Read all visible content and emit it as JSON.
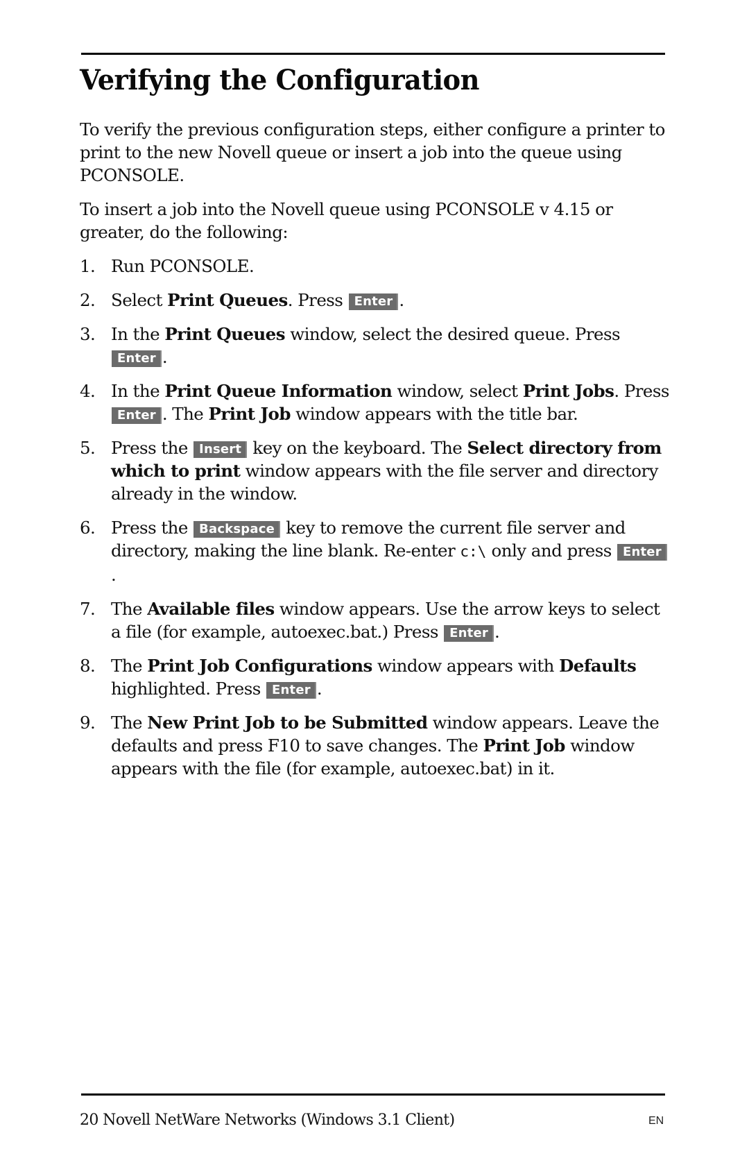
{
  "page": {
    "title": "Verifying the Configuration",
    "intro": [
      [
        {
          "t": "To verify the previous configuration steps, either configure a printer to print to the new Novell queue or insert a job into the queue using PCONSOLE."
        }
      ],
      [
        {
          "t": "To insert a job into the Novell queue using PCONSOLE v 4.15 or greater, do the following:"
        }
      ]
    ],
    "steps": [
      {
        "num": "1.",
        "runs": [
          {
            "t": "Run PCONSOLE."
          }
        ]
      },
      {
        "num": "2.",
        "runs": [
          {
            "t": "Select "
          },
          {
            "t": "Print Queues",
            "s": "b"
          },
          {
            "t": ". Press "
          },
          {
            "t": "Enter",
            "s": "key"
          },
          {
            "t": "."
          }
        ]
      },
      {
        "num": "3.",
        "runs": [
          {
            "t": "In the "
          },
          {
            "t": "Print Queues",
            "s": "b"
          },
          {
            "t": " window, select the desired queue. Press "
          },
          {
            "t": "Enter",
            "s": "key"
          },
          {
            "t": "."
          }
        ]
      },
      {
        "num": "4.",
        "runs": [
          {
            "t": "In the "
          },
          {
            "t": "Print Queue Information",
            "s": "b"
          },
          {
            "t": " window, select "
          },
          {
            "t": "Print Jobs",
            "s": "b"
          },
          {
            "t": ". Press "
          },
          {
            "t": "Enter",
            "s": "key"
          },
          {
            "t": ". The "
          },
          {
            "t": "Print Job",
            "s": "b"
          },
          {
            "t": " window appears with the title bar."
          }
        ]
      },
      {
        "num": "5.",
        "runs": [
          {
            "t": "Press the "
          },
          {
            "t": "Insert",
            "s": "key"
          },
          {
            "t": " key on the keyboard. The "
          },
          {
            "t": "Select directory from which to print",
            "s": "b"
          },
          {
            "t": " window appears with the file server and directory already in the window."
          }
        ]
      },
      {
        "num": "6.",
        "runs": [
          {
            "t": "Press the "
          },
          {
            "t": "Backspace",
            "s": "key"
          },
          {
            "t": " key to remove the current file server and directory, making the line blank. Re-enter "
          },
          {
            "t": "c:\\",
            "s": "mono"
          },
          {
            "t": " only and press "
          },
          {
            "t": "Enter",
            "s": "key"
          },
          {
            "t": "."
          }
        ]
      },
      {
        "num": "7.",
        "runs": [
          {
            "t": "The "
          },
          {
            "t": "Available files",
            "s": "b"
          },
          {
            "t": " window appears. Use the arrow keys to select a file (for example, autoexec.bat.) Press "
          },
          {
            "t": "Enter",
            "s": "key"
          },
          {
            "t": "."
          }
        ]
      },
      {
        "num": "8.",
        "runs": [
          {
            "t": "The "
          },
          {
            "t": "Print Job Configurations",
            "s": "b"
          },
          {
            "t": " window appears with "
          },
          {
            "t": "Defaults",
            "s": "b"
          },
          {
            "t": " highlighted. Press "
          },
          {
            "t": "Enter",
            "s": "key"
          },
          {
            "t": "."
          }
        ]
      },
      {
        "num": "9.",
        "runs": [
          {
            "t": "The "
          },
          {
            "t": "New Print Job to be Submitted",
            "s": "b"
          },
          {
            "t": " window appears. Leave the defaults and press F10 to save changes. The "
          },
          {
            "t": "Print Job",
            "s": "b"
          },
          {
            "t": " window appears with the file (for example, autoexec.bat) in it."
          }
        ]
      }
    ],
    "footer": {
      "text": "20 Novell NetWare Networks (Windows 3.1 Client)",
      "lang": "EN"
    }
  },
  "colors": {
    "key_background": "#6b6b6b",
    "key_text": "#ffffff",
    "rule": "#000000"
  }
}
